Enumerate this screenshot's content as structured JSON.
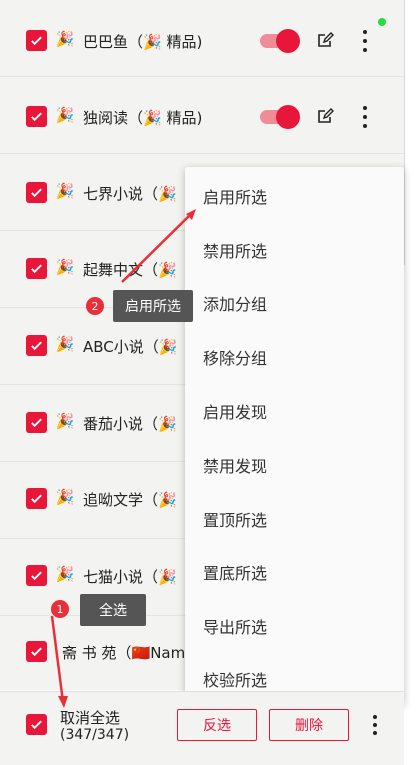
{
  "sources": [
    {
      "emoji": "🎉",
      "name": "巴巴鱼（🎉 精品)",
      "toggle": true
    },
    {
      "emoji": "🎉",
      "name": "独阅读（🎉 精品)",
      "toggle": true
    },
    {
      "emoji": "🎉",
      "name": "七界小说（🎉"
    },
    {
      "emoji": "🎉",
      "name": "起舞中文（🎉"
    },
    {
      "emoji": "🎉",
      "name": "ABC小说（🎉"
    },
    {
      "emoji": "🎉",
      "name": "番茄小说（🎉"
    },
    {
      "emoji": "🎉",
      "name": "追呦文学（🎉"
    },
    {
      "emoji": "🎉",
      "name": "七猫小说（🎉"
    },
    {
      "emoji": "",
      "name": "斋 书 苑（🇨🇳Nam"
    }
  ],
  "menu": {
    "items": [
      "启用所选",
      "禁用所选",
      "添加分组",
      "移除分组",
      "启用发现",
      "禁用发现",
      "置顶所选",
      "置底所选",
      "导出所选",
      "校验所选"
    ]
  },
  "bottom": {
    "select_label": "取消全选",
    "count": "(347/347)",
    "invert_label": "反选",
    "delete_label": "删除"
  },
  "annotations": {
    "step1_number": "1",
    "step1_label": "全选",
    "step2_number": "2",
    "step2_label": "启用所选"
  },
  "colors": {
    "accent": "#e8173a",
    "toggle_track": "#f08b98",
    "tooltip": "#555555",
    "status_dot": "#22dd44"
  }
}
